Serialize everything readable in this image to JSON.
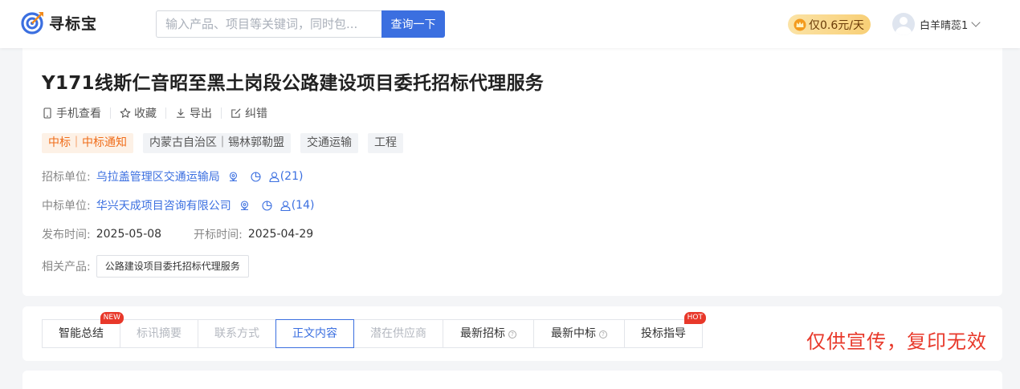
{
  "colors": {
    "accent": "#3b6fe0",
    "orange": "#f06d1a",
    "red": "#e8382a",
    "vip_bg": "#f8cf76"
  },
  "header": {
    "logo_text": "寻标宝",
    "search_placeholder": "输入产品、项目等关键词，同时包...",
    "search_button": "查询一下",
    "vip_label": "仅0.6元/天",
    "user_name": "白羊晴蕊1"
  },
  "detail": {
    "title": "Y171线斯仁音昭至黑土岗段公路建设项目委托招标代理服务",
    "actions": [
      {
        "label": "手机查看",
        "icon": "phone-icon"
      },
      {
        "label": "收藏",
        "icon": "star-icon"
      },
      {
        "label": "导出",
        "icon": "download-icon"
      },
      {
        "label": "纠错",
        "icon": "edit-icon"
      }
    ],
    "tags": [
      "中标｜中标通知",
      "内蒙古自治区｜锡林郭勒盟",
      "交通运输",
      "工程"
    ],
    "tender_unit_label": "招标单位:",
    "tender_unit": "乌拉盖管理区交通运输局",
    "tender_contacts": "(21)",
    "winner_unit_label": "中标单位:",
    "winner_unit": "华兴天成项目咨询有限公司",
    "winner_contacts": "(14)",
    "publish_label": "发布时间:",
    "publish_date": "2025-05-08",
    "open_label": "开标时间:",
    "open_date": "2025-04-29",
    "product_label": "相关产品:",
    "product": "公路建设项目委托招标代理服务"
  },
  "tabs": [
    {
      "label": "智能总结",
      "badge": "NEW",
      "state": "normal"
    },
    {
      "label": "标讯摘要",
      "state": "dim"
    },
    {
      "label": "联系方式",
      "state": "dim"
    },
    {
      "label": "正文内容",
      "state": "active"
    },
    {
      "label": "潜在供应商",
      "state": "dim"
    },
    {
      "label": "最新招标",
      "state": "normal",
      "help": "?"
    },
    {
      "label": "最新中标",
      "state": "normal",
      "help": "?"
    },
    {
      "label": "投标指导",
      "badge": "HOT",
      "state": "normal"
    }
  ],
  "watermark": "仅供宣传，复印无效"
}
